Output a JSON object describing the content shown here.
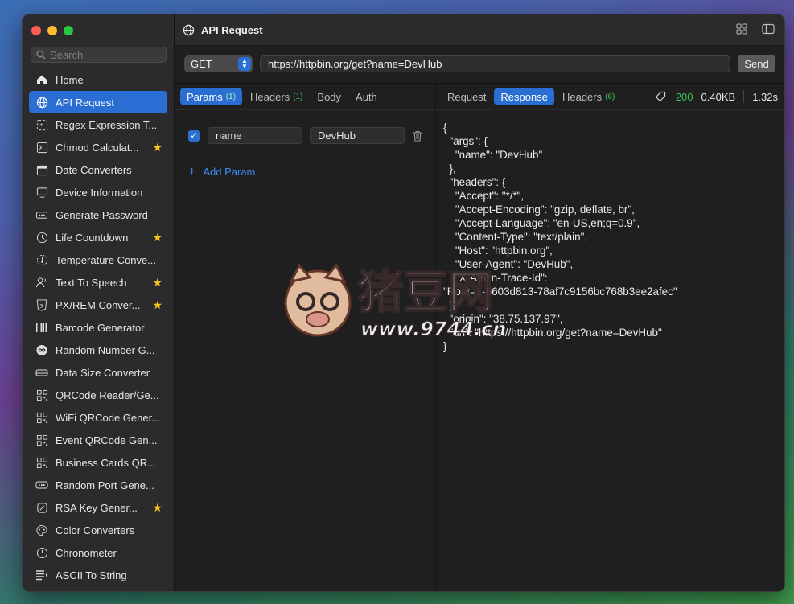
{
  "window": {
    "title": "API Request"
  },
  "sidebar": {
    "search_placeholder": "Search",
    "items": [
      {
        "label": "Home",
        "icon": "home-icon",
        "starred": false,
        "active": false
      },
      {
        "label": "API Request",
        "icon": "globe-icon",
        "starred": false,
        "active": true
      },
      {
        "label": "Regex Expression T...",
        "icon": "regex-icon",
        "starred": false,
        "active": false
      },
      {
        "label": "Chmod Calculat...",
        "icon": "terminal-icon",
        "starred": true,
        "active": false
      },
      {
        "label": "Date Converters",
        "icon": "calendar-icon",
        "starred": false,
        "active": false
      },
      {
        "label": "Device Information",
        "icon": "monitor-icon",
        "starred": false,
        "active": false
      },
      {
        "label": "Generate Password",
        "icon": "password-icon",
        "starred": false,
        "active": false
      },
      {
        "label": "Life Countdown",
        "icon": "countdown-icon",
        "starred": true,
        "active": false
      },
      {
        "label": "Temperature Conve...",
        "icon": "thermometer-icon",
        "starred": false,
        "active": false
      },
      {
        "label": "Text To Speech",
        "icon": "speech-icon",
        "starred": true,
        "active": false
      },
      {
        "label": "PX/REM Conver...",
        "icon": "css-icon",
        "starred": true,
        "active": false
      },
      {
        "label": "Barcode Generator",
        "icon": "barcode-icon",
        "starred": false,
        "active": false
      },
      {
        "label": "Random Number G...",
        "icon": "infinity-icon",
        "starred": false,
        "active": false
      },
      {
        "label": "Data Size Converter",
        "icon": "disk-icon",
        "starred": false,
        "active": false
      },
      {
        "label": "QRCode Reader/Ge...",
        "icon": "qrcode-icon",
        "starred": false,
        "active": false
      },
      {
        "label": "WiFi QRCode Gener...",
        "icon": "qrcode-icon",
        "starred": false,
        "active": false
      },
      {
        "label": "Event QRCode Gen...",
        "icon": "qrcode-icon",
        "starred": false,
        "active": false
      },
      {
        "label": "Business Cards QR...",
        "icon": "qrcode-icon",
        "starred": false,
        "active": false
      },
      {
        "label": "Random Port Gene...",
        "icon": "port-icon",
        "starred": false,
        "active": false
      },
      {
        "label": "RSA Key Gener...",
        "icon": "key-icon",
        "starred": true,
        "active": false
      },
      {
        "label": "Color Converters",
        "icon": "palette-icon",
        "starred": false,
        "active": false
      },
      {
        "label": "Chronometer",
        "icon": "clock-icon",
        "starred": false,
        "active": false
      },
      {
        "label": "ASCII To String",
        "icon": "ascii-icon",
        "starred": false,
        "active": false
      }
    ]
  },
  "request": {
    "method": "GET",
    "url": "https://httpbin.org/get?name=DevHub",
    "send_label": "Send"
  },
  "left_tabs": {
    "params": {
      "label": "Params",
      "count": "(1)"
    },
    "headers": {
      "label": "Headers",
      "count": "(1)"
    },
    "body": {
      "label": "Body"
    },
    "auth": {
      "label": "Auth"
    }
  },
  "params": [
    {
      "key": "name",
      "value": "DevHub",
      "checked": true
    }
  ],
  "add_param_label": "Add Param",
  "right_tabs": {
    "request": {
      "label": "Request"
    },
    "response": {
      "label": "Response"
    },
    "headers": {
      "label": "Headers",
      "count": "(6)"
    }
  },
  "status": {
    "code": "200",
    "size": "0.40KB",
    "time": "1.32s"
  },
  "response_body": "{\n  \"args\": {\n    \"name\": \"DevHub\"\n  },\n  \"headers\": {\n    \"Accept\": \"*/*\",\n    \"Accept-Encoding\": \"gzip, deflate, br\",\n    \"Accept-Language\": \"en-US,en;q=0.9\",\n    \"Content-Type\": \"text/plain\",\n    \"Host\": \"httpbin.org\",\n    \"User-Agent\": \"DevHub\",\n    \"X-Amzn-Trace-Id\":\n\"Root=1-6603d813-78af7c9156bc768b3ee2afec\"\n  },\n  \"origin\": \"38.75.137.97\",\n  \"url\": \"https://httpbin.org/get?name=DevHub\"\n}",
  "watermark": {
    "text": "猪豆网",
    "url_text": "www.9744.cn"
  },
  "colors": {
    "accent": "#2a6ed3",
    "success": "#39c25c",
    "star": "#f5c518",
    "link": "#3d8bf2"
  }
}
